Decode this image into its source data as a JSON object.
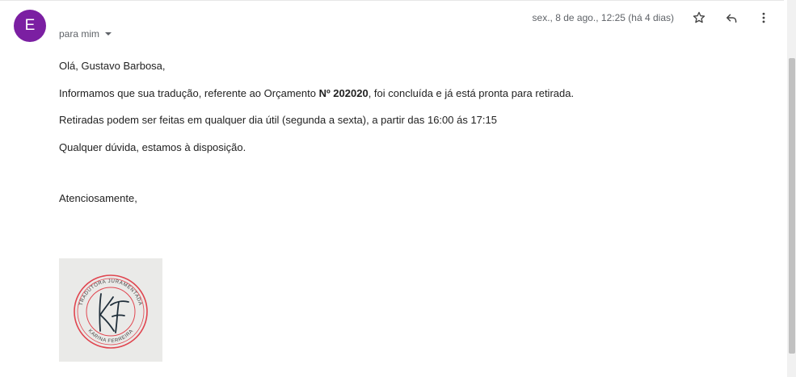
{
  "sender": {
    "avatar_initial": "E",
    "avatar_color": "#7b1fa2",
    "recipient_label": "para mim"
  },
  "header": {
    "date": "sex., 8 de ago., 12:25 (há 4 dias)",
    "icons": [
      "star-icon",
      "reply-icon",
      "more-vert-icon"
    ]
  },
  "message": {
    "greeting": "Olá, Gustavo Barbosa,",
    "line1_before": "Informamos que sua tradução, referente ao Orçamento ",
    "line1_bold": "Nº 202020",
    "line1_after": ", foi concluída e já está pronta para retirada.",
    "line2": "Retiradas podem ser feitas em qualquer dia útil (segunda a sexta), a partir das 16:00 ás 17:15",
    "line3": "Qualquer dúvida, estamos à disposição.",
    "signoff": "Atenciosamente,"
  },
  "signature_logo": {
    "monogram": "KF",
    "ring_text_top": "TRADUTORA JURAMENTADA",
    "ring_text_bottom": "KARINA FERREIRA",
    "ring_color": "#e0454f"
  }
}
